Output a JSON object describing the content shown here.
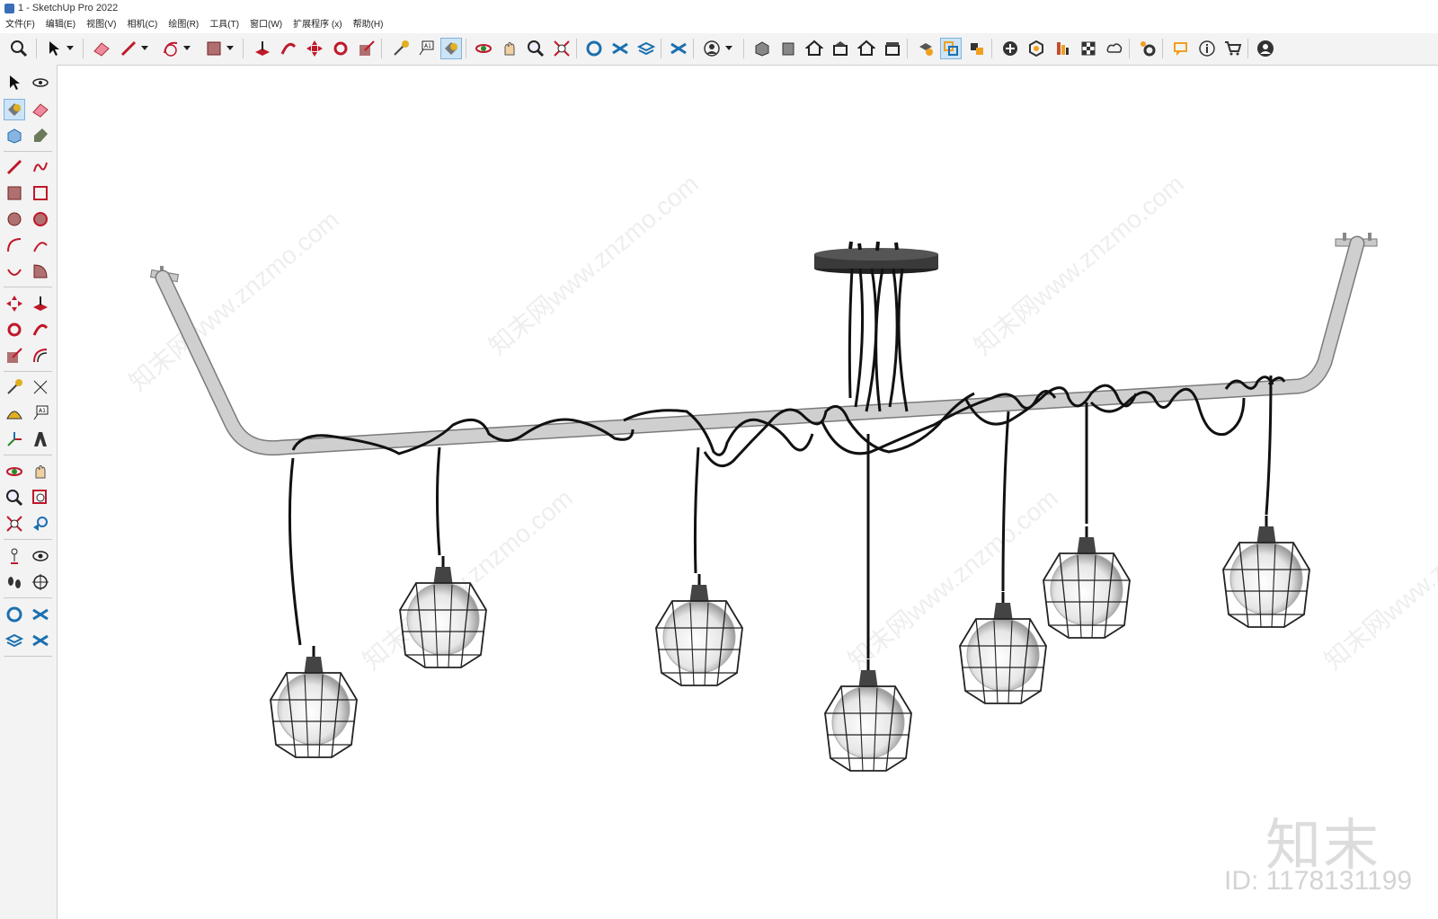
{
  "window": {
    "title": "1 - SketchUp Pro 2022"
  },
  "menu": {
    "items": [
      "文件(F)",
      "编辑(E)",
      "视图(V)",
      "相机(C)",
      "绘图(R)",
      "工具(T)",
      "窗口(W)",
      "扩展程序 (x)",
      "帮助(H)"
    ]
  },
  "toolbar": {
    "icons": [
      "zoom-icon",
      "select-icon",
      "dropdown-icon",
      "eraser-icon",
      "pencil-icon",
      "dropdown-icon",
      "arc-icon",
      "dropdown-icon",
      "rectangle-icon",
      "dropdown-icon",
      "push-pull-icon",
      "follow-me-icon",
      "move-icon",
      "rotate-icon",
      "scale-icon",
      "tape-measure-icon",
      "text-icon",
      "paint-bucket-icon",
      "orbit-icon",
      "pan-icon",
      "zoom-tool-icon",
      "zoom-extents-icon",
      "warehouse-icon",
      "extension-warehouse-icon",
      "layout-icon",
      "extension-manager-icon",
      "user-icon",
      "dropdown-icon",
      "iso-view-icon",
      "front-view-icon",
      "top-view-icon",
      "right-view-icon",
      "back-view-icon",
      "left-view-icon",
      "solid-tools-icon",
      "outer-shell-icon",
      "section-icon",
      "add-location-icon",
      "photo-textures-icon",
      "model-info-icon",
      "soften-icon",
      "cloud-icon",
      "settings-icon",
      "chat-icon",
      "info-icon",
      "cart-icon",
      "account-icon"
    ]
  },
  "watermark": {
    "logo": "知末",
    "id_label": "ID: 1178131199",
    "diagonal": "知末网www.znzmo.com"
  },
  "colors": {
    "pipe": "#c9c9c9",
    "pipe_edge": "#7a7a7a",
    "cable": "#111111",
    "canopy": "#3a3a3a",
    "active": "#cde4f7"
  }
}
